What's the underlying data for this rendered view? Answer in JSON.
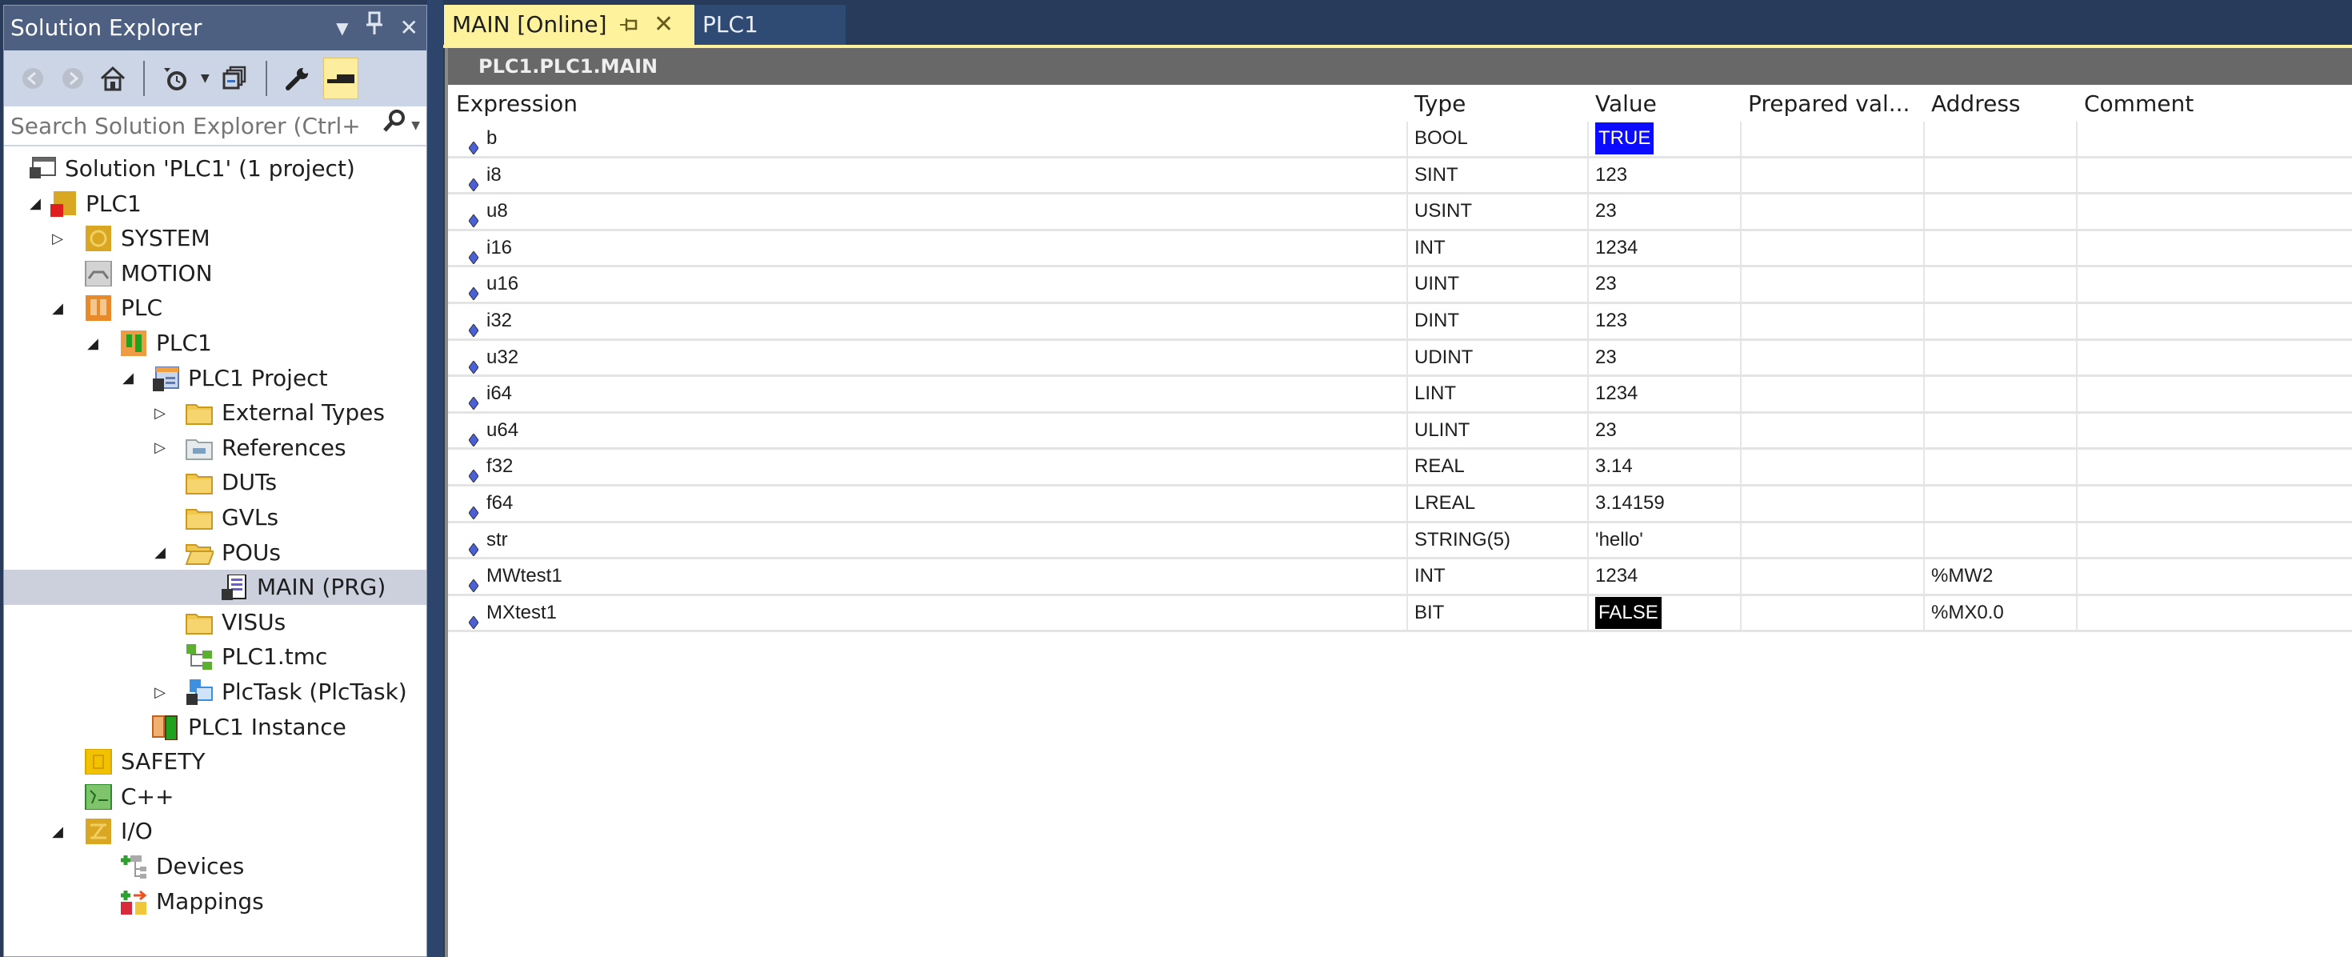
{
  "solution_explorer": {
    "title": "Solution Explorer",
    "header_icons": [
      "dropdown-arrow-icon",
      "pin-icon",
      "close-icon"
    ],
    "toolbar": [
      "back-icon",
      "forward-icon",
      "home-icon",
      "pending-changes-filter-icon",
      "dropdown-arrow-icon",
      "collapse-all-icon",
      "properties-wrench-icon",
      "preview-selected-icon"
    ],
    "search_placeholder": "Search Solution Explorer (Ctrl+;",
    "tree": [
      {
        "label": "Solution 'PLC1' (1 project)",
        "level": 0,
        "expander": "",
        "icon": "solution-icon",
        "selected": false
      },
      {
        "label": "PLC1",
        "level": 0,
        "expander": "expanded",
        "icon": "twincat-project-icon",
        "selected": false
      },
      {
        "label": "SYSTEM",
        "level": 1,
        "expander": "collapsed",
        "icon": "system-icon",
        "selected": false
      },
      {
        "label": "MOTION",
        "level": 1,
        "expander": "",
        "icon": "motion-icon",
        "selected": false
      },
      {
        "label": "PLC",
        "level": 1,
        "expander": "expanded",
        "icon": "plc-icon",
        "selected": false
      },
      {
        "label": "PLC1",
        "level": 2,
        "expander": "expanded",
        "icon": "plc-project-icon",
        "selected": false
      },
      {
        "label": "PLC1 Project",
        "level": 3,
        "expander": "expanded",
        "icon": "plc-project-file-icon",
        "selected": false
      },
      {
        "label": "External Types",
        "level": 4,
        "expander": "collapsed",
        "icon": "folder-icon",
        "selected": false
      },
      {
        "label": "References",
        "level": 4,
        "expander": "collapsed",
        "icon": "references-icon",
        "selected": false
      },
      {
        "label": "DUTs",
        "level": 4,
        "expander": "",
        "icon": "folder-icon",
        "selected": false
      },
      {
        "label": "GVLs",
        "level": 4,
        "expander": "",
        "icon": "folder-icon",
        "selected": false
      },
      {
        "label": "POUs",
        "level": 4,
        "expander": "expanded",
        "icon": "folder-open-icon",
        "selected": false
      },
      {
        "label": "MAIN (PRG)",
        "level": 5,
        "expander": "",
        "icon": "program-icon",
        "selected": true
      },
      {
        "label": "VISUs",
        "level": 4,
        "expander": "",
        "icon": "folder-icon",
        "selected": false
      },
      {
        "label": "PLC1.tmc",
        "level": 4,
        "expander": "",
        "icon": "tmc-icon",
        "selected": false
      },
      {
        "label": "PlcTask (PlcTask)",
        "level": 4,
        "expander": "collapsed",
        "icon": "task-icon",
        "selected": false
      },
      {
        "label": "PLC1 Instance",
        "level": 3,
        "expander": "",
        "icon": "instance-icon",
        "selected": false
      },
      {
        "label": "SAFETY",
        "level": 1,
        "expander": "",
        "icon": "safety-icon",
        "selected": false
      },
      {
        "label": "C++",
        "level": 1,
        "expander": "",
        "icon": "cpp-icon",
        "selected": false
      },
      {
        "label": "I/O",
        "level": 1,
        "expander": "expanded",
        "icon": "io-icon",
        "selected": false
      },
      {
        "label": "Devices",
        "level": 2,
        "expander": "",
        "icon": "devices-icon",
        "selected": false
      },
      {
        "label": "Mappings",
        "level": 2,
        "expander": "",
        "icon": "mappings-icon",
        "selected": false
      }
    ]
  },
  "tabs": [
    {
      "label": "MAIN [Online]",
      "active": true,
      "pin_glyph": "⊣",
      "close_glyph": "✕"
    },
    {
      "label": "PLC1",
      "active": false
    }
  ],
  "editor": {
    "path": "PLC1.PLC1.MAIN",
    "columns": [
      "Expression",
      "Type",
      "Value",
      "Prepared val...",
      "Address",
      "Comment"
    ],
    "rows": [
      {
        "expression": "b",
        "type": "BOOL",
        "value": "TRUE",
        "value_style": "true",
        "prepared": "",
        "address": "",
        "comment": ""
      },
      {
        "expression": "i8",
        "type": "SINT",
        "value": "123",
        "value_style": "",
        "prepared": "",
        "address": "",
        "comment": ""
      },
      {
        "expression": "u8",
        "type": "USINT",
        "value": "23",
        "value_style": "",
        "prepared": "",
        "address": "",
        "comment": ""
      },
      {
        "expression": "i16",
        "type": "INT",
        "value": "1234",
        "value_style": "",
        "prepared": "",
        "address": "",
        "comment": ""
      },
      {
        "expression": "u16",
        "type": "UINT",
        "value": "23",
        "value_style": "",
        "prepared": "",
        "address": "",
        "comment": ""
      },
      {
        "expression": "i32",
        "type": "DINT",
        "value": "123",
        "value_style": "",
        "prepared": "",
        "address": "",
        "comment": ""
      },
      {
        "expression": "u32",
        "type": "UDINT",
        "value": "23",
        "value_style": "",
        "prepared": "",
        "address": "",
        "comment": ""
      },
      {
        "expression": "i64",
        "type": "LINT",
        "value": "1234",
        "value_style": "",
        "prepared": "",
        "address": "",
        "comment": ""
      },
      {
        "expression": "u64",
        "type": "ULINT",
        "value": "23",
        "value_style": "",
        "prepared": "",
        "address": "",
        "comment": ""
      },
      {
        "expression": "f32",
        "type": "REAL",
        "value": "3.14",
        "value_style": "",
        "prepared": "",
        "address": "",
        "comment": ""
      },
      {
        "expression": "f64",
        "type": "LREAL",
        "value": "3.14159",
        "value_style": "",
        "prepared": "",
        "address": "",
        "comment": ""
      },
      {
        "expression": "str",
        "type": "STRING(5)",
        "value": "'hello'",
        "value_style": "",
        "prepared": "",
        "address": "",
        "comment": ""
      },
      {
        "expression": "MWtest1",
        "type": "INT",
        "value": "1234",
        "value_style": "",
        "prepared": "",
        "address": "%MW2",
        "comment": ""
      },
      {
        "expression": "MXtest1",
        "type": "BIT",
        "value": "FALSE",
        "value_style": "false",
        "prepared": "",
        "address": "%MX0.0",
        "comment": ""
      }
    ]
  },
  "colors": {
    "true_value_bg": "#0b0bff",
    "false_value_bg": "#000000",
    "active_tab_bg": "#fff29d",
    "selected_tree_bg": "#ccd0dd",
    "panel_header_bg": "#4d6082"
  }
}
